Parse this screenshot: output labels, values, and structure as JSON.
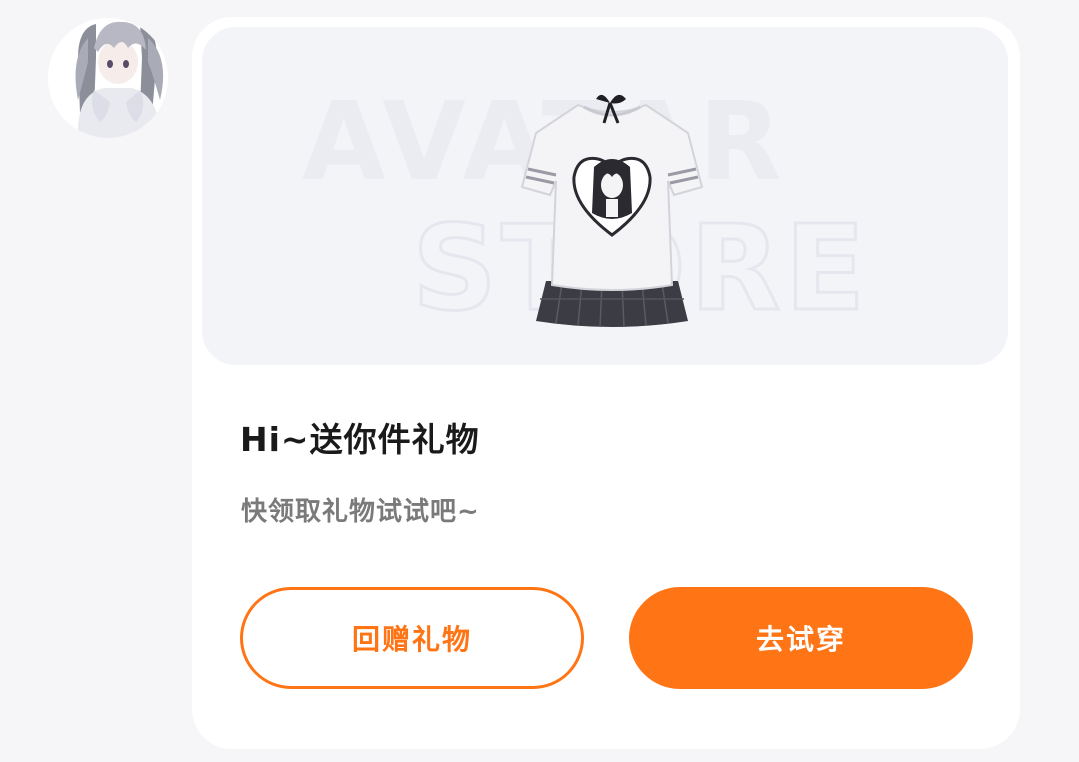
{
  "message": {
    "title": "Hi~送你件礼物",
    "subtitle": "快领取礼物试试吧~",
    "watermark_line1": "AVATAR",
    "watermark_line2": "STORE"
  },
  "actions": {
    "return_gift_label": "回赠礼物",
    "try_on_label": "去试穿"
  },
  "colors": {
    "accent": "#ff7414",
    "card_bg": "#ffffff",
    "banner_bg": "#f3f4f8",
    "page_bg": "#f6f6f8"
  },
  "icons": {
    "avatar": "anime-girl-avatar",
    "product": "tshirt-skirt-outfit"
  }
}
